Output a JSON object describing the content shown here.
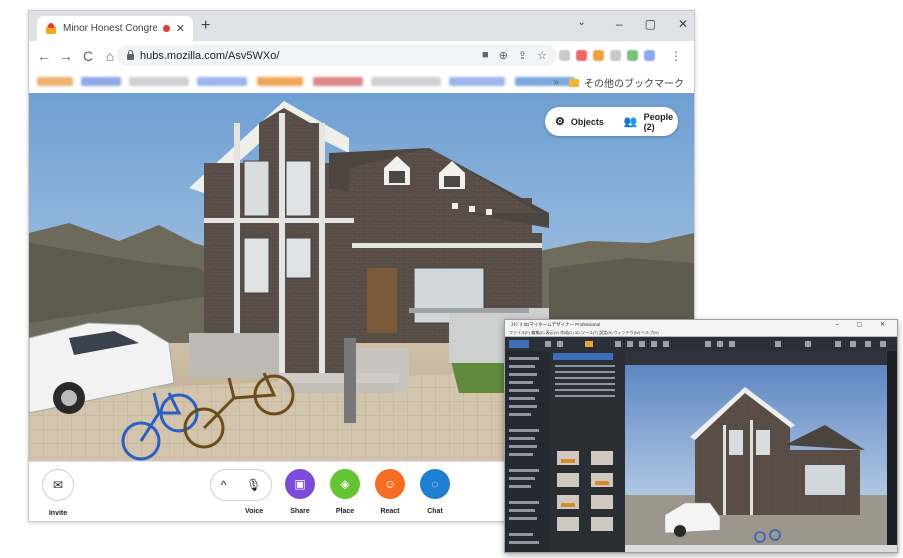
{
  "browser": {
    "tab_title": "Minor Honest Congregation",
    "tab_close": "✕",
    "new_tab": "+",
    "window_controls": [
      "⌄",
      "–",
      "▢",
      "✕"
    ],
    "nav": {
      "back": "←",
      "forward": "→",
      "reload": "C",
      "home": "⌂"
    },
    "url": "hubs.mozilla.com/Asv5WXo/",
    "bookmarks_other": "その他のブックマーク",
    "bookmarks_more": "»"
  },
  "hubs": {
    "objects_label": "Objects",
    "people_label": "People (2)",
    "toolbar": [
      {
        "id": "invite",
        "label": "Invite",
        "icon": "✉",
        "color": "#ffffff"
      },
      {
        "id": "share",
        "label": "Share",
        "icon": "▣",
        "color": "#7b4bd9"
      },
      {
        "id": "place",
        "label": "Place",
        "icon": "◈",
        "color": "#64c433"
      },
      {
        "id": "react",
        "label": "React",
        "icon": "☺",
        "color": "#f46d22"
      },
      {
        "id": "chat",
        "label": "Chat",
        "icon": "◌",
        "color": "#1e7ed2"
      }
    ],
    "voice_label": "Voice",
    "voice_chevron": "^",
    "voice_mic": "🎙"
  },
  "software": {
    "title": "ｽﾀｼﾞｵ 3Dマイホームデザイナー Professional",
    "menu": "ファイル(F)  編集(E)  表示(V)  作成(C)  3D  ツール(T)  設定(S)  ウィンドウ(W)  ヘルプ(H)",
    "window_controls": "–  ▢  ✕"
  },
  "colors": {
    "sky_top": "#6f9fd3",
    "sky_bottom": "#c3d6ea",
    "brick": "#5a4f47",
    "trim": "#e4e4e0"
  }
}
